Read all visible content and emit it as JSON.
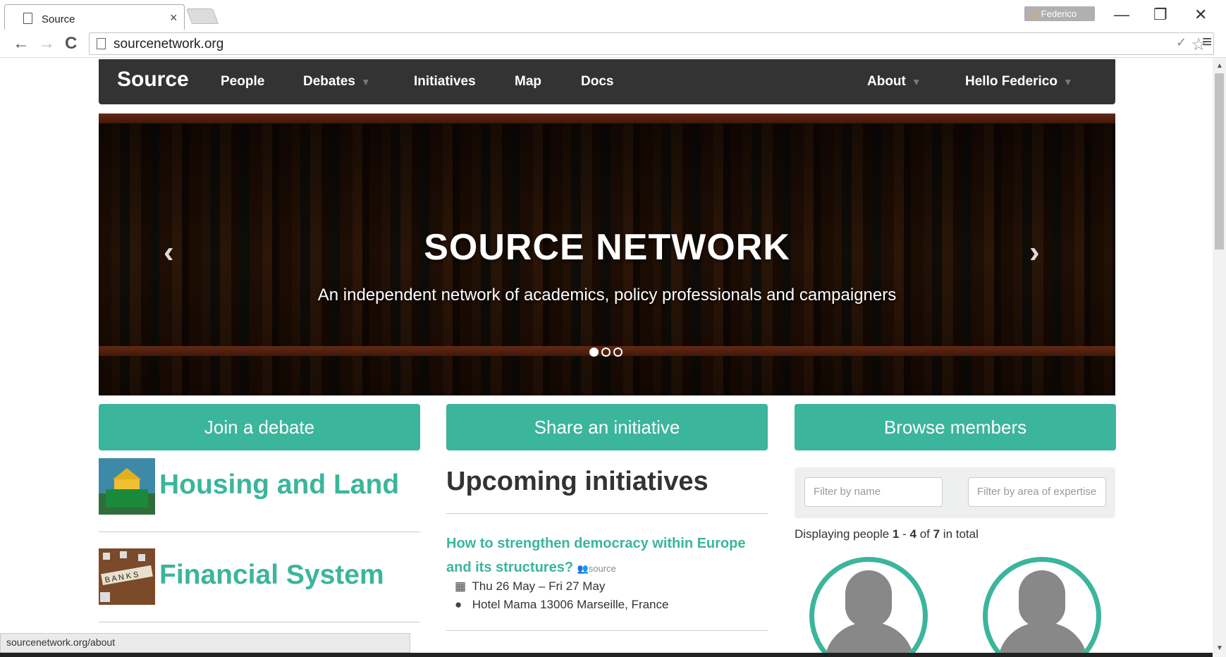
{
  "browser": {
    "tab_title": "Source",
    "tab_close": "×",
    "profile_name": "Federico",
    "url": "sourcenetwork.org",
    "status_url": "sourcenetwork.org/about"
  },
  "icons": {
    "minimize": "—",
    "restore": "❐",
    "close": "✕",
    "back": "←",
    "forward": "→",
    "reload": "C",
    "star": "☆",
    "check": "✓",
    "menu": "≡",
    "warning": "⚠",
    "calendar": "📅",
    "marker": "⚲",
    "arrow_left": "‹",
    "arrow_right": "›"
  },
  "navbar": {
    "brand": "Source",
    "links": [
      "People",
      "Debates",
      "Initiatives",
      "Map",
      "Docs"
    ],
    "about": "About",
    "user": "Hello Federico"
  },
  "hero": {
    "title": "SOURCE NETWORK",
    "subtitle": "An independent network of academics, policy professionals and campaigners"
  },
  "cta": {
    "debate": "Join a debate",
    "initiative": "Share an initiative",
    "members": "Browse members"
  },
  "debates": [
    {
      "title": "Housing and Land"
    },
    {
      "title": "Financial System"
    }
  ],
  "initiatives": {
    "heading": "Upcoming initiatives",
    "items": [
      {
        "title": "How to strengthen democracy within Europe and its structures?",
        "tag": "source",
        "dates": "Thu 26 May – Fri 27 May",
        "location": "Hotel Mama 13006 Marseille, France"
      }
    ]
  },
  "members": {
    "filter_name_placeholder": "Filter by name",
    "filter_area_placeholder": "Filter by area of expertise",
    "count_prefix": "Displaying people ",
    "count_from": "1",
    "count_sep": " - ",
    "count_to": "4",
    "count_of": " of ",
    "count_total": "7",
    "count_suffix": " in total"
  },
  "colors": {
    "accent": "#3bb59c",
    "navbar": "#333333"
  }
}
